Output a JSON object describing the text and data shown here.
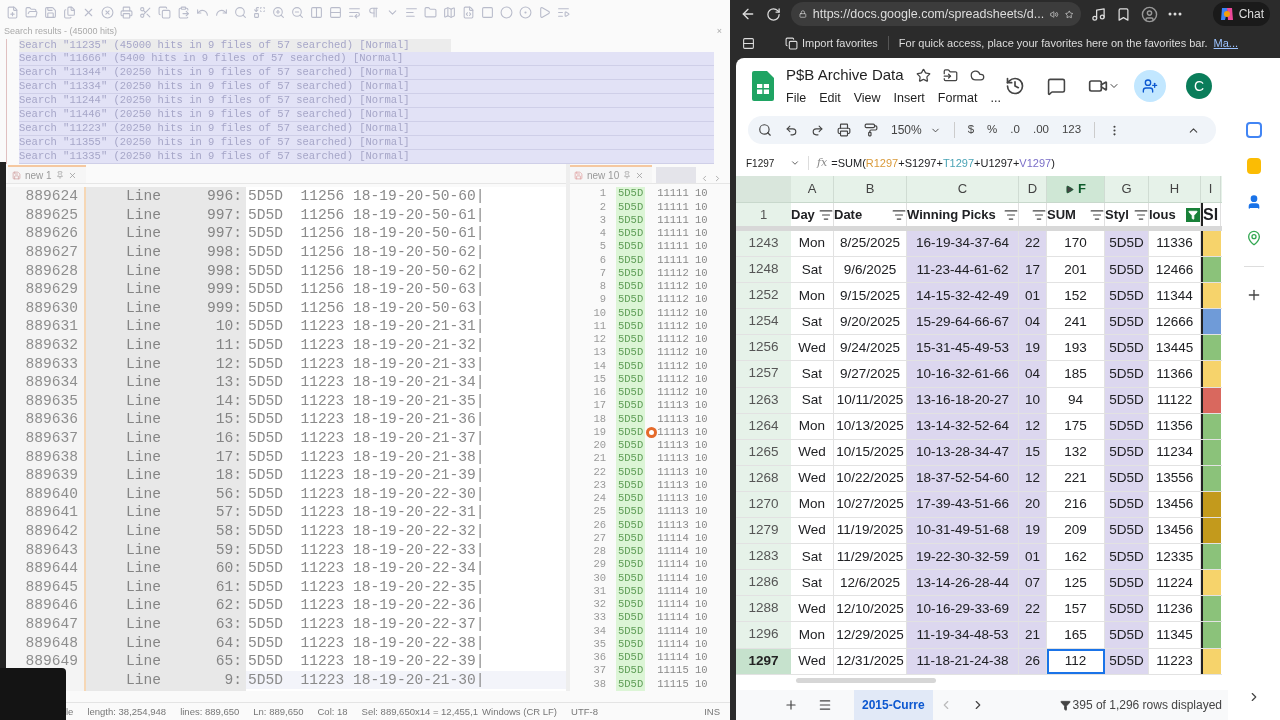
{
  "search_results": {
    "title": "Search results - (45000 hits)",
    "close": "×",
    "items": [
      {
        "text": "Search \"11235\" (45000 hits in 9 files of 57 searched) [Normal]",
        "selected": false
      },
      {
        "text": "Search \"11666\" (5400 hits in 9 files of 57 searched) [Normal]",
        "selected": true
      },
      {
        "text": "Search \"11344\" (20250 hits in 9 files of 57 searched) [Normal]",
        "selected": true
      },
      {
        "text": "Search \"11334\" (20250 hits in 9 files of 57 searched) [Normal]",
        "selected": true
      },
      {
        "text": "Search \"11244\" (20250 hits in 9 files of 57 searched) [Normal]",
        "selected": true
      },
      {
        "text": "Search \"11446\" (20250 hits in 9 files of 57 searched) [Normal]",
        "selected": true
      },
      {
        "text": "Search \"11223\" (20250 hits in 9 files of 57 searched) [Normal]",
        "selected": true
      },
      {
        "text": "Search \"11355\" (20250 hits in 9 files of 57 searched) [Normal]",
        "selected": true
      },
      {
        "text": "Search \"11335\" (20250 hits in 9 files of 57 searched) [Normal]",
        "selected": true
      }
    ]
  },
  "editor": {
    "tab": "new 1",
    "lines": [
      {
        "number": "889624",
        "label": "Line",
        "ref": "996:",
        "text": "5D5D  11256 18-19-20-50-60|"
      },
      {
        "number": "889625",
        "label": "Line",
        "ref": "997:",
        "text": "5D5D  11256 18-19-20-50-61|"
      },
      {
        "number": "889626",
        "label": "Line",
        "ref": "997:",
        "text": "5D5D  11256 18-19-20-50-61|"
      },
      {
        "number": "889627",
        "label": "Line",
        "ref": "998:",
        "text": "5D5D  11256 18-19-20-50-62|"
      },
      {
        "number": "889628",
        "label": "Line",
        "ref": "998:",
        "text": "5D5D  11256 18-19-20-50-62|"
      },
      {
        "number": "889629",
        "label": "Line",
        "ref": "999:",
        "text": "5D5D  11256 18-19-20-50-63|"
      },
      {
        "number": "889630",
        "label": "Line",
        "ref": "999:",
        "text": "5D5D  11256 18-19-20-50-63|"
      },
      {
        "number": "889631",
        "label": "Line",
        "ref": "10:",
        "text": "5D5D  11223 18-19-20-21-31|"
      },
      {
        "number": "889632",
        "label": "Line",
        "ref": "11:",
        "text": "5D5D  11223 18-19-20-21-32|"
      },
      {
        "number": "889633",
        "label": "Line",
        "ref": "12:",
        "text": "5D5D  11223 18-19-20-21-33|"
      },
      {
        "number": "889634",
        "label": "Line",
        "ref": "13:",
        "text": "5D5D  11223 18-19-20-21-34|"
      },
      {
        "number": "889635",
        "label": "Line",
        "ref": "14:",
        "text": "5D5D  11223 18-19-20-21-35|"
      },
      {
        "number": "889636",
        "label": "Line",
        "ref": "15:",
        "text": "5D5D  11223 18-19-20-21-36|"
      },
      {
        "number": "889637",
        "label": "Line",
        "ref": "16:",
        "text": "5D5D  11223 18-19-20-21-37|"
      },
      {
        "number": "889638",
        "label": "Line",
        "ref": "17:",
        "text": "5D5D  11223 18-19-20-21-38|"
      },
      {
        "number": "889639",
        "label": "Line",
        "ref": "18:",
        "text": "5D5D  11223 18-19-20-21-39|"
      },
      {
        "number": "889640",
        "label": "Line",
        "ref": "56:",
        "text": "5D5D  11223 18-19-20-22-30|"
      },
      {
        "number": "889641",
        "label": "Line",
        "ref": "57:",
        "text": "5D5D  11223 18-19-20-22-31|"
      },
      {
        "number": "889642",
        "label": "Line",
        "ref": "58:",
        "text": "5D5D  11223 18-19-20-22-32|"
      },
      {
        "number": "889643",
        "label": "Line",
        "ref": "59:",
        "text": "5D5D  11223 18-19-20-22-33|"
      },
      {
        "number": "889644",
        "label": "Line",
        "ref": "60:",
        "text": "5D5D  11223 18-19-20-22-34|"
      },
      {
        "number": "889645",
        "label": "Line",
        "ref": "61:",
        "text": "5D5D  11223 18-19-20-22-35|"
      },
      {
        "number": "889646",
        "label": "Line",
        "ref": "62:",
        "text": "5D5D  11223 18-19-20-22-36|"
      },
      {
        "number": "889647",
        "label": "Line",
        "ref": "63:",
        "text": "5D5D  11223 18-19-20-22-37|"
      },
      {
        "number": "889648",
        "label": "Line",
        "ref": "64:",
        "text": "5D5D  11223 18-19-20-22-38|"
      },
      {
        "number": "889649",
        "label": "Line",
        "ref": "65:",
        "text": "5D5D  11223 18-19-20-22-39|"
      },
      {
        "label": "Line",
        "ref": "9:",
        "text": "5D5D  11223 18-19-20-21-30|"
      }
    ]
  },
  "editor2": {
    "tab": "new 10",
    "lines": [
      {
        "number": "1",
        "code": "5D5D",
        "text": "11111 10"
      },
      {
        "number": "2",
        "code": "5D5D",
        "text": "11111 10"
      },
      {
        "number": "3",
        "code": "5D5D",
        "text": "11111 10"
      },
      {
        "number": "4",
        "code": "5D5D",
        "text": "11111 10"
      },
      {
        "number": "5",
        "code": "5D5D",
        "text": "11111 10"
      },
      {
        "number": "6",
        "code": "5D5D",
        "text": "11111 10"
      },
      {
        "number": "7",
        "code": "5D5D",
        "text": "11112 10"
      },
      {
        "number": "8",
        "code": "5D5D",
        "text": "11112 10"
      },
      {
        "number": "9",
        "code": "5D5D",
        "text": "11112 10"
      },
      {
        "number": "10",
        "code": "5D5D",
        "text": "11112 10"
      },
      {
        "number": "11",
        "code": "5D5D",
        "text": "11112 10"
      },
      {
        "number": "12",
        "code": "5D5D",
        "text": "11112 10"
      },
      {
        "number": "13",
        "code": "5D5D",
        "text": "11112 10"
      },
      {
        "number": "14",
        "code": "5D5D",
        "text": "11112 10"
      },
      {
        "number": "15",
        "code": "5D5D",
        "text": "11112 10"
      },
      {
        "number": "16",
        "code": "5D5D",
        "text": "11112 10"
      },
      {
        "number": "17",
        "code": "5D5D",
        "text": "11113 10"
      },
      {
        "number": "18",
        "code": "5D5D",
        "text": "11113 10"
      },
      {
        "number": "19",
        "code": "5D5D",
        "text": "11113 10"
      },
      {
        "number": "20",
        "code": "5D5D",
        "text": "11113 10"
      },
      {
        "number": "21",
        "code": "5D5D",
        "text": "11113 10"
      },
      {
        "number": "22",
        "code": "5D5D",
        "text": "11113 10"
      },
      {
        "number": "23",
        "code": "5D5D",
        "text": "11113 10"
      },
      {
        "number": "24",
        "code": "5D5D",
        "text": "11113 10"
      },
      {
        "number": "25",
        "code": "5D5D",
        "text": "11113 10"
      },
      {
        "number": "26",
        "code": "5D5D",
        "text": "11113 10"
      },
      {
        "number": "27",
        "code": "5D5D",
        "text": "11114 10"
      },
      {
        "number": "28",
        "code": "5D5D",
        "text": "11114 10"
      },
      {
        "number": "29",
        "code": "5D5D",
        "text": "11114 10"
      },
      {
        "number": "30",
        "code": "5D5D",
        "text": "11114 10"
      },
      {
        "number": "31",
        "code": "5D5D",
        "text": "11114 10"
      },
      {
        "number": "32",
        "code": "5D5D",
        "text": "11114 10"
      },
      {
        "number": "33",
        "code": "5D5D",
        "text": "11114 10"
      },
      {
        "number": "34",
        "code": "5D5D",
        "text": "11114 10"
      },
      {
        "number": "35",
        "code": "5D5D",
        "text": "11114 10"
      },
      {
        "number": "36",
        "code": "5D5D",
        "text": "11114 10"
      },
      {
        "number": "37",
        "code": "5D5D",
        "text": "11115 10"
      },
      {
        "number": "38",
        "code": "5D5D",
        "text": "11115 10"
      }
    ]
  },
  "status_bar": [
    "le",
    "length: 38,254,948",
    "lines: 889,650",
    "Ln: 889,650",
    "Col: 18",
    "Sel: 889,650x14 = 12,455,1",
    "Windows (CR LF)",
    "UTF-8",
    "INS"
  ],
  "browser": {
    "url": "https://docs.google.com/spreadsheets/d...",
    "chat": "Chat",
    "import_favorites": "Import favorites",
    "favorites_hint": "For quick access, place your favorites here on the favorites bar.",
    "favorites_link": "Ma..."
  },
  "sheet": {
    "title": "P$B Archive Data",
    "menu": [
      "File",
      "Edit",
      "View",
      "Insert",
      "Format",
      "..."
    ],
    "avatar": "C",
    "zoom": "150%",
    "toolbar_texts": [
      "$",
      "%",
      ".0",
      ".00",
      "123"
    ],
    "cell_ref": "F1297",
    "fx": "fx",
    "formula_parts": [
      {
        "text": "=SUM("
      },
      {
        "text": "R1297",
        "color": "#d99a3a"
      },
      {
        "text": "+S1297+"
      },
      {
        "text": "T1297",
        "color": "#4aa3b5"
      },
      {
        "text": "+U1297+"
      },
      {
        "text": "V1297",
        "color": "#7b6fc8"
      },
      {
        "text": ")"
      }
    ],
    "columns": [
      {
        "label": "A",
        "selected": false
      },
      {
        "label": "B",
        "selected": false
      },
      {
        "label": "C",
        "selected": false
      },
      {
        "label": "D",
        "selected": false
      },
      {
        "label": "F",
        "selected": true
      },
      {
        "label": "G",
        "selected": false
      },
      {
        "label": "H",
        "selected": false
      },
      {
        "label": "I",
        "selected": false
      }
    ],
    "header_row": "1",
    "headers": [
      {
        "text": "Day",
        "filtered": false
      },
      {
        "text": "Date",
        "filtered": false
      },
      {
        "text": "Winning Picks",
        "filtered": false
      },
      {
        "filtered": false
      },
      {
        "text": "SUM",
        "filtered": false
      },
      {
        "text": "Styl",
        "filtered": false
      },
      {
        "text": "lous",
        "filtered": true
      },
      {
        "text": "Sl"
      }
    ],
    "rows": [
      {
        "row": "1243",
        "cells": [
          "Mon",
          "8/25/2025",
          "16-19-34-37-64",
          "22",
          "170",
          "5D5D",
          "11336"
        ],
        "color": "#f6d36b",
        "selected": false
      },
      {
        "row": "1248",
        "cells": [
          "Sat",
          "9/6/2025",
          "11-23-44-61-62",
          "17",
          "201",
          "5D5D",
          "12466"
        ],
        "color": "#8bc27a",
        "selected": false
      },
      {
        "row": "1252",
        "cells": [
          "Mon",
          "9/15/2025",
          "14-15-32-42-49",
          "01",
          "152",
          "5D5D",
          "11344"
        ],
        "color": "#f6d36b",
        "selected": false
      },
      {
        "row": "1254",
        "cells": [
          "Sat",
          "9/20/2025",
          "15-29-64-66-67",
          "04",
          "241",
          "5D5D",
          "12666"
        ],
        "color": "#6f9bd8",
        "selected": false
      },
      {
        "row": "1256",
        "cells": [
          "Wed",
          "9/24/2025",
          "15-31-45-49-53",
          "19",
          "193",
          "5D5D",
          "13445"
        ],
        "color": "#8bc27a",
        "selected": false
      },
      {
        "row": "1257",
        "cells": [
          "Sat",
          "9/27/2025",
          "10-16-32-61-66",
          "04",
          "185",
          "5D5D",
          "11366"
        ],
        "color": "#f6d36b",
        "selected": false
      },
      {
        "row": "1263",
        "cells": [
          "Sat",
          "10/11/2025",
          "13-16-18-20-27",
          "10",
          "94",
          "5D5D",
          "11122"
        ],
        "color": "#d9685e",
        "selected": false
      },
      {
        "row": "1264",
        "cells": [
          "Mon",
          "10/13/2025",
          "13-14-32-52-64",
          "12",
          "175",
          "5D5D",
          "11356"
        ],
        "color": "#8bc27a",
        "selected": false
      },
      {
        "row": "1265",
        "cells": [
          "Wed",
          "10/15/2025",
          "10-13-28-34-47",
          "15",
          "132",
          "5D5D",
          "11234"
        ],
        "color": "#8bc27a",
        "selected": false
      },
      {
        "row": "1268",
        "cells": [
          "Wed",
          "10/22/2025",
          "18-37-52-54-60",
          "12",
          "221",
          "5D5D",
          "13556"
        ],
        "color": "#8bc27a",
        "selected": false
      },
      {
        "row": "1270",
        "cells": [
          "Mon",
          "10/27/2025",
          "17-39-43-51-66",
          "20",
          "216",
          "5D5D",
          "13456"
        ],
        "color": "#c39a1c",
        "selected": false
      },
      {
        "row": "1279",
        "cells": [
          "Wed",
          "11/19/2025",
          "10-31-49-51-68",
          "19",
          "209",
          "5D5D",
          "13456"
        ],
        "color": "#c39a1c",
        "selected": false
      },
      {
        "row": "1283",
        "cells": [
          "Sat",
          "11/29/2025",
          "19-22-30-32-59",
          "01",
          "162",
          "5D5D",
          "12335"
        ],
        "color": "#8bc27a",
        "selected": false
      },
      {
        "row": "1286",
        "cells": [
          "Sat",
          "12/6/2025",
          "13-14-26-28-44",
          "07",
          "125",
          "5D5D",
          "11224"
        ],
        "color": "#f6d36b",
        "selected": false
      },
      {
        "row": "1288",
        "cells": [
          "Wed",
          "12/10/2025",
          "10-16-29-33-69",
          "22",
          "157",
          "5D5D",
          "11236"
        ],
        "color": "#8bc27a",
        "selected": false
      },
      {
        "row": "1296",
        "cells": [
          "Mon",
          "12/29/2025",
          "11-19-34-48-53",
          "21",
          "165",
          "5D5D",
          "11345"
        ],
        "color": "#8bc27a",
        "selected": false
      },
      {
        "row": "1297",
        "cells": [
          "Wed",
          "12/31/2025",
          "11-18-21-24-38",
          "26",
          "112",
          "5D5D",
          "11223"
        ],
        "color": "#f6d36b",
        "selected": true
      }
    ],
    "sheet_tabs": [
      {
        "label": "2015-Curre",
        "selected": true
      }
    ],
    "rows_displayed": "395 of 1,296 rows displayed"
  }
}
